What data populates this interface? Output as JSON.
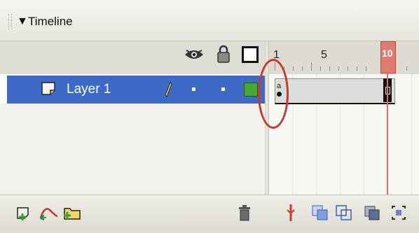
{
  "panel": {
    "title": "Timeline"
  },
  "ruler": {
    "labels": [
      "1",
      "5",
      "10"
    ]
  },
  "layer": {
    "name": "Layer 1"
  },
  "keyframe": {
    "action_mark": "a"
  },
  "icons": {
    "collapse": "triangle-down",
    "visibility": "eye",
    "lock": "padlock",
    "outline": "outline-square",
    "layer_type": "layer",
    "edit": "pencil",
    "insert_layer": "insert-layer",
    "motion_guide": "add-motion-guide",
    "insert_folder": "insert-folder",
    "delete": "trash-can",
    "center_frame": "center-frame",
    "onion_skin": "onion-skin",
    "onion_outlines": "onion-skin-outlines",
    "edit_multiple": "edit-multiple-frames",
    "onion_markers": "modify-onion-markers"
  },
  "colors": {
    "layer_selected": "#3d69c7",
    "outline_swatch": "#44aa33",
    "playhead": "#e07a6f",
    "annotation": "#c8392b"
  }
}
